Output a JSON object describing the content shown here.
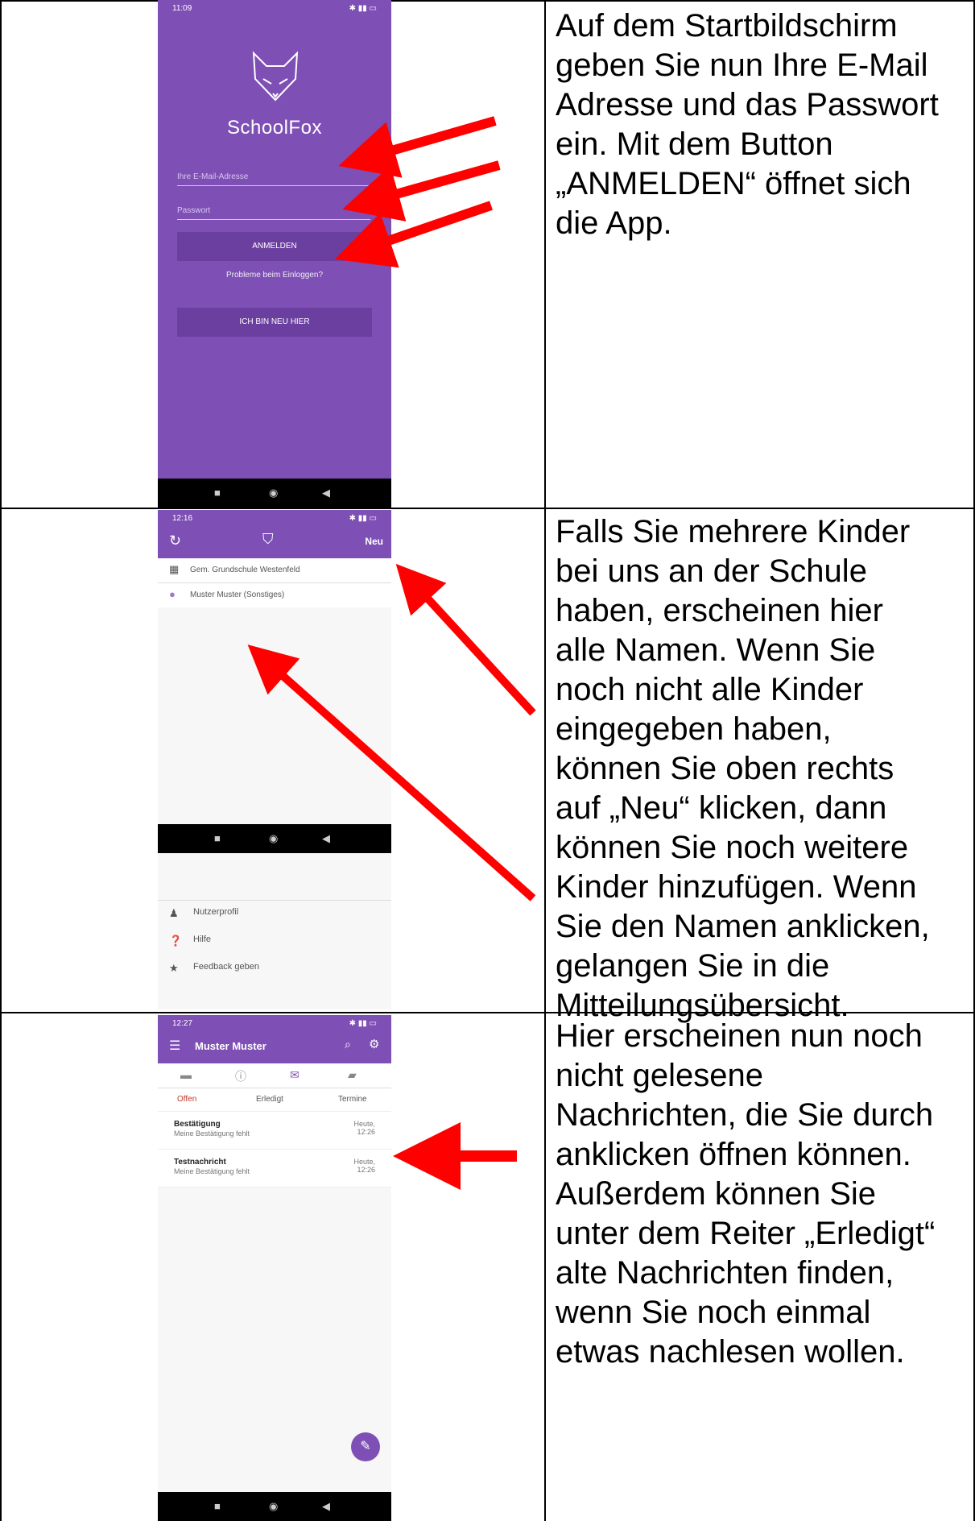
{
  "rows": [
    {
      "text": "Auf dem Startbildschirm geben Sie nun Ihre E-Mail Adresse und das Passwort ein. Mit dem Button „ANMELDEN“ öffnet sich die App.",
      "lines": [
        "Auf dem Startbildschirm",
        "geben Sie nun Ihre E-Mail",
        "Adresse und das Passwort",
        "ein. Mit dem Button",
        "„ANMELDEN“ öffnet sich",
        "die App."
      ]
    },
    {
      "lines": [
        "Falls Sie mehrere Kinder",
        "bei uns an der Schule",
        "haben, erscheinen hier",
        "alle Namen. Wenn Sie",
        "noch nicht alle Kinder",
        "eingegeben haben,",
        "können Sie oben rechts",
        "auf „Neu“ klicken, dann",
        "können Sie noch weitere",
        "Kinder hinzufügen. Wenn",
        "Sie den Namen anklicken,",
        "gelangen Sie in die",
        "Mitteilungsübersicht."
      ]
    },
    {
      "lines": [
        "Hier erscheinen nun noch",
        "nicht gelesene",
        "Nachrichten, die Sie durch",
        "anklicken öffnen können.",
        "Außerdem können Sie",
        "unter dem Reiter „Erledigt“",
        "alte Nachrichten finden,",
        "wenn Sie noch einmal",
        "etwas nachlesen wollen."
      ]
    }
  ],
  "screen1": {
    "time": "11:09",
    "brand": "SchoolFox",
    "email_placeholder": "Ihre E-Mail-Adresse",
    "password_placeholder": "Passwort",
    "login_button": "ANMELDEN",
    "trouble_link": "Probleme beim Einloggen?",
    "new_button": "ICH BIN NEU HIER"
  },
  "screen2": {
    "time": "12:16",
    "new_label": "Neu",
    "school": "Gem. Grundschule Westenfeld",
    "child": "Muster Muster (Sonstiges)",
    "menu": [
      "Nutzerprofil",
      "Hilfe",
      "Feedback geben"
    ]
  },
  "screen3": {
    "time": "12:27",
    "title": "Muster Muster",
    "tabs": [
      "Offen",
      "Erledigt",
      "Termine"
    ],
    "messages": [
      {
        "title": "Bestätigung",
        "sub": "Meine Bestätigung fehlt",
        "date1": "Heute,",
        "date2": "12:26"
      },
      {
        "title": "Testnachricht",
        "sub": "Meine Bestätigung fehlt",
        "date1": "Heute,",
        "date2": "12:26"
      }
    ]
  },
  "colors": {
    "purple": "#7e4fb5",
    "arrow": "#ff0000"
  }
}
